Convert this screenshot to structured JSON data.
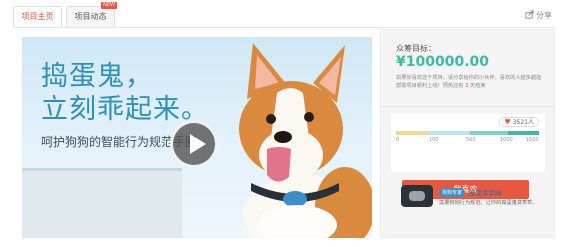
{
  "tabs": [
    {
      "label": "项目主页",
      "active": true
    },
    {
      "label": "项目动态",
      "badge": "NEW"
    }
  ],
  "share_label": "分享",
  "video": {
    "headline_1": "捣蛋鬼，",
    "headline_2": "立刻乖起来。",
    "subline": "呵护狗狗的智能行为规范手圈"
  },
  "panel": {
    "goal_label": "众筹目标：",
    "goal_value": "¥100000.00",
    "desc_prefix": "如果你喜欢这个项目，请分享给你的小伙伴，喜欢的人越多越能帮助项目顺利上线！预热还有 ",
    "days_left": "3",
    "desc_suffix": " 天结束",
    "likes": "3521人",
    "progress_ticks": [
      "0",
      "100",
      "500",
      "1000",
      "1500"
    ],
    "like_button": "我喜欢",
    "brand_badge": "狗狗专家",
    "brand_name": "宠爱幸幸网",
    "brand_desc": "需要狗狗行为规范，让你的捣蛋鬼变乖乖。"
  },
  "colors": {
    "accent": "#e9573f",
    "teal": "#3fb8a6",
    "bar_segments": [
      "#f3d79a",
      "#bfe3f2",
      "#7fd0cc",
      "#3fb8a6"
    ]
  }
}
